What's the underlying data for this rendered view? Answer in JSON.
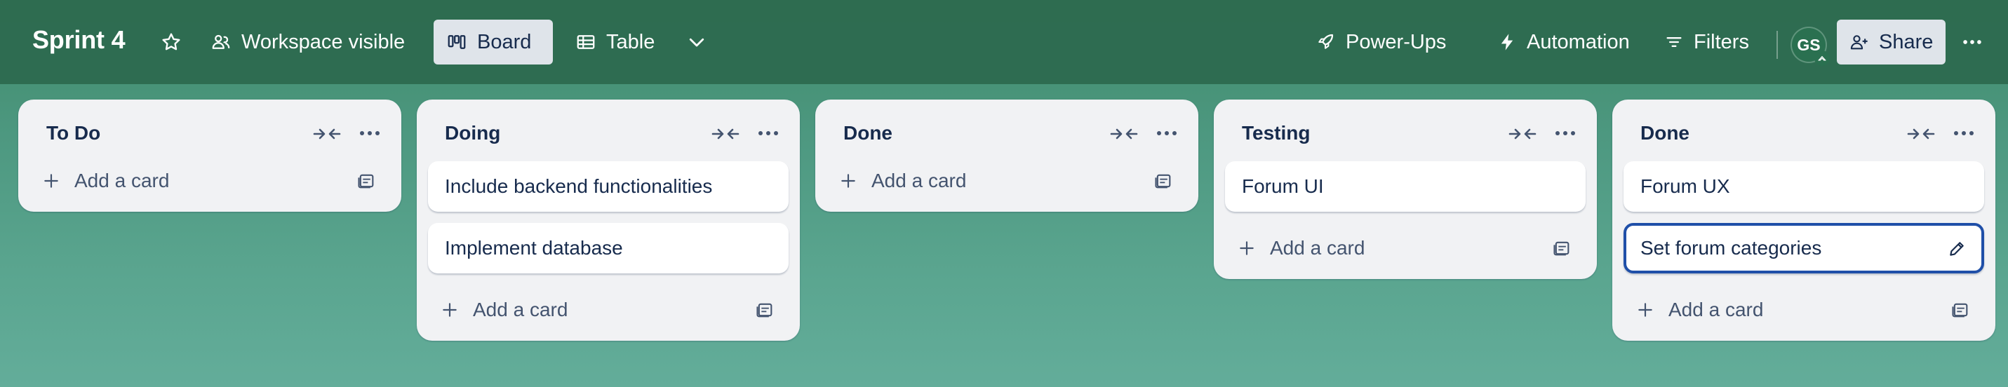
{
  "board": {
    "title": "Sprint 4",
    "visibility_label": "Workspace visible",
    "views": [
      {
        "label": "Board",
        "icon": "board-icon",
        "active": true
      },
      {
        "label": "Table",
        "icon": "table-icon",
        "active": false
      }
    ]
  },
  "header_actions": {
    "powerups_label": "Power-Ups",
    "automation_label": "Automation",
    "filters_label": "Filters",
    "share_label": "Share",
    "avatar_initials": "GS"
  },
  "lists": [
    {
      "title": "To Do",
      "cards": [],
      "add_label": "Add a card"
    },
    {
      "title": "Doing",
      "cards": [
        {
          "title": "Include backend functionalities"
        },
        {
          "title": "Implement database"
        }
      ],
      "add_label": "Add a card"
    },
    {
      "title": "Done",
      "cards": [],
      "add_label": "Add a card"
    },
    {
      "title": "Testing",
      "cards": [
        {
          "title": "Forum UI"
        }
      ],
      "add_label": "Add a card"
    },
    {
      "title": "Done",
      "cards": [
        {
          "title": "Forum UX"
        },
        {
          "title": "Set forum categories",
          "editing": true
        }
      ],
      "add_label": "Add a card"
    }
  ],
  "colors": {
    "header_bg": "#2d694e",
    "board_bg": "#4d9880",
    "list_bg": "#f1f2f4",
    "card_bg": "#ffffff",
    "edit_border": "#1f4fa8",
    "text": "#172b4d"
  }
}
